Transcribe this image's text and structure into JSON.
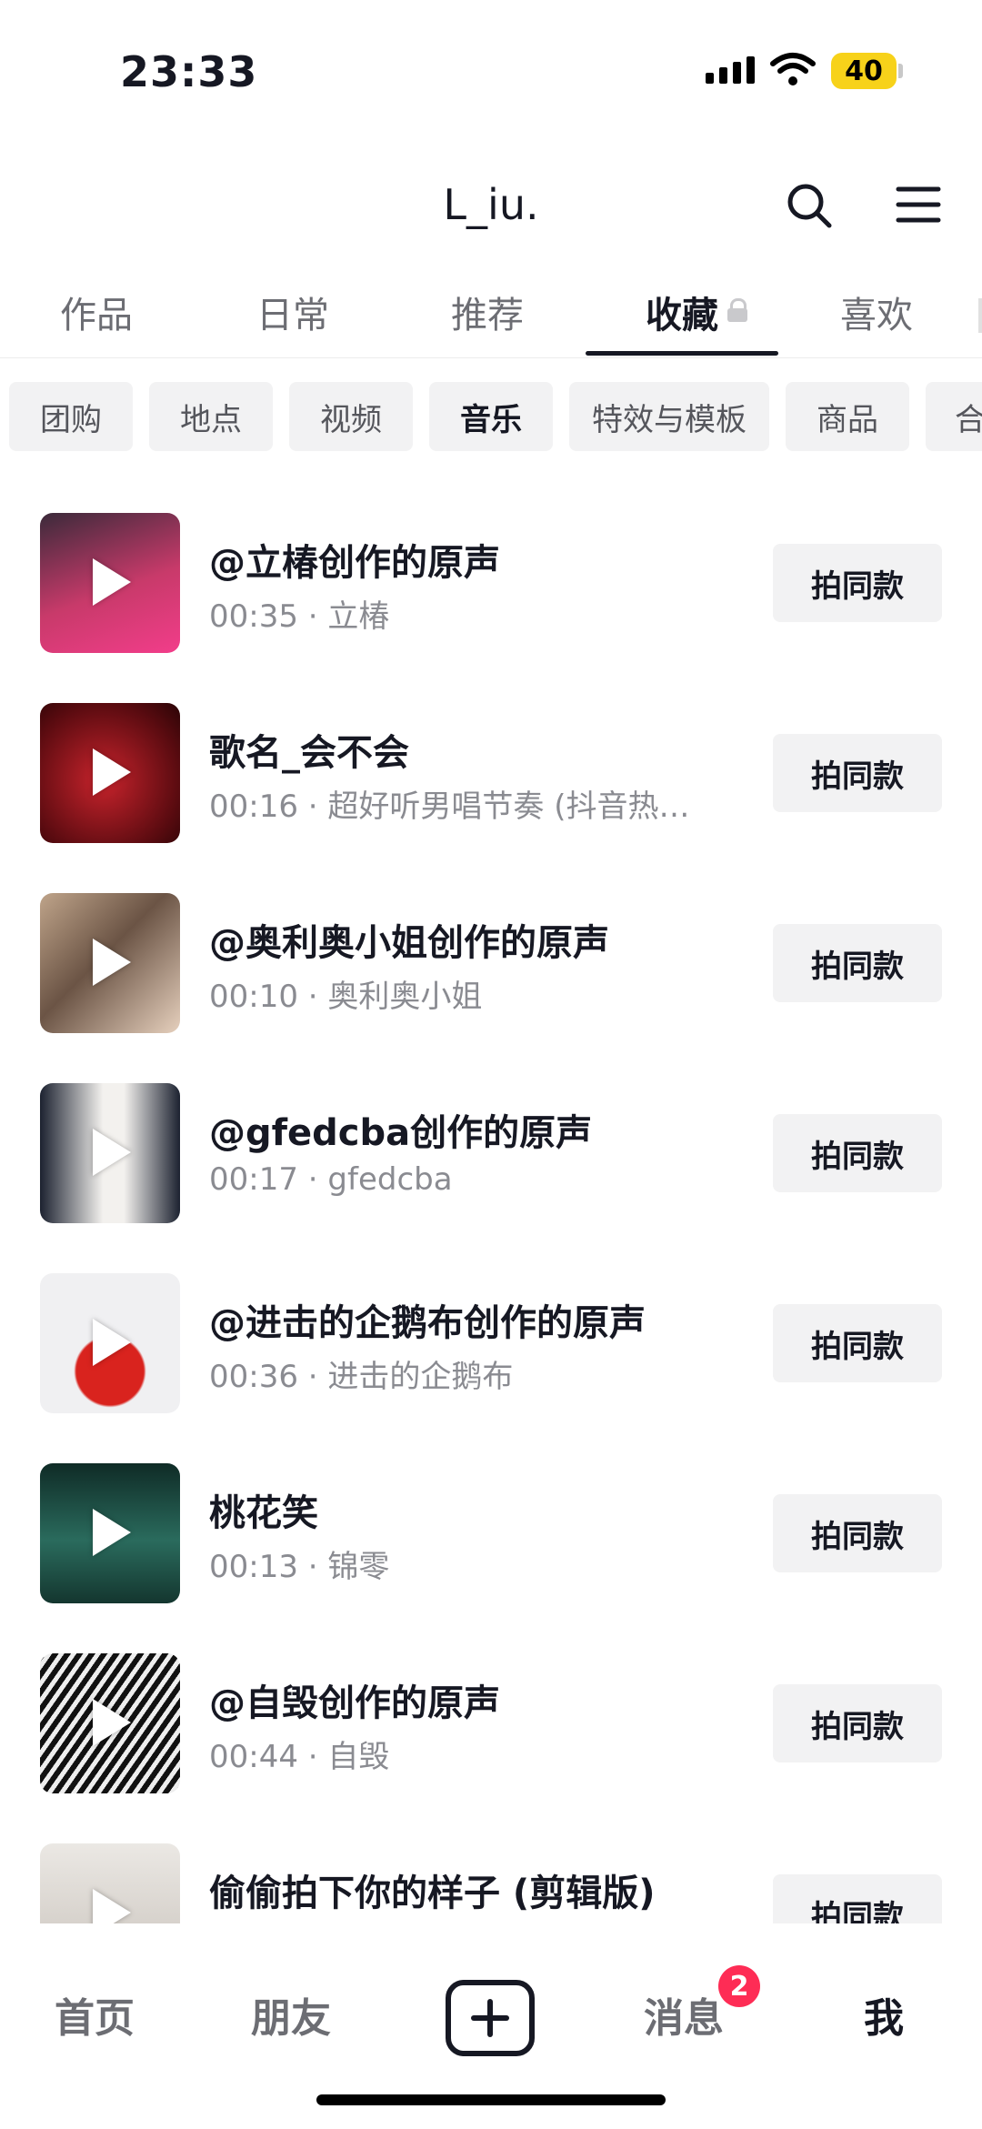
{
  "status": {
    "time": "23:33",
    "battery": "40"
  },
  "header": {
    "title": "L_iu."
  },
  "tabs": [
    {
      "label": "作品"
    },
    {
      "label": "日常"
    },
    {
      "label": "推荐"
    },
    {
      "label": "收藏"
    },
    {
      "label": "喜欢"
    }
  ],
  "chips": [
    {
      "label": "团购"
    },
    {
      "label": "地点"
    },
    {
      "label": "视频"
    },
    {
      "label": "音乐"
    },
    {
      "label": "特效与模板"
    },
    {
      "label": "商品"
    },
    {
      "label": "合"
    }
  ],
  "items": [
    {
      "title": "@立椿创作的原声",
      "meta": "00:35 · 立椿",
      "action": "拍同款",
      "thumb": "#a8264f"
    },
    {
      "title": "歌名_会不会",
      "meta": "00:16 · 超好听男唱节奏 (抖音热…",
      "action": "拍同款",
      "thumb": "#7a0c12"
    },
    {
      "title": "@奥利奥小姐创作的原声",
      "meta": "00:10 · 奥利奥小姐",
      "action": "拍同款",
      "thumb": "#8a6f5d"
    },
    {
      "title": "@gfedcba创作的原声",
      "meta": "00:17 · gfedcba",
      "action": "拍同款",
      "thumb": "#2a2b30"
    },
    {
      "title": "@进击的企鹅布创作的原声",
      "meta": "00:36 · 进击的企鹅布",
      "action": "拍同款",
      "thumb": "#e9e9ec"
    },
    {
      "title": "桃花笑",
      "meta": "00:13 · 锦零",
      "action": "拍同款",
      "thumb": "#1f5a4e"
    },
    {
      "title": "@自毁创作的原声",
      "meta": "00:44 · 自毁",
      "action": "拍同款",
      "thumb": "#3a3a3a"
    },
    {
      "title": "偷偷拍下你的样子 (剪辑版)",
      "meta": "",
      "action": "拍同款",
      "thumb": "#d9d6d2"
    }
  ],
  "nav": {
    "home": "首页",
    "friends": "朋友",
    "messages": "消息",
    "messages_badge": "2",
    "me": "我"
  }
}
